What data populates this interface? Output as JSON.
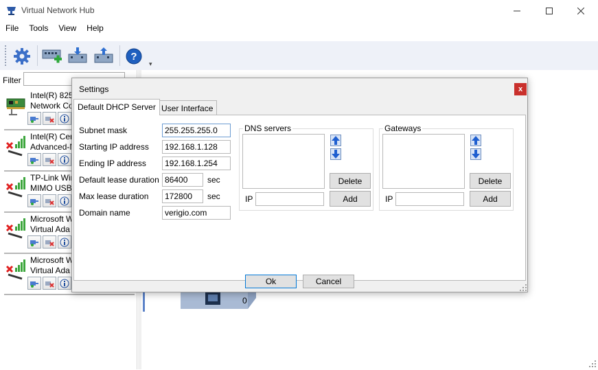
{
  "window": {
    "title": "Virtual Network Hub"
  },
  "menu": [
    "File",
    "Tools",
    "View",
    "Help"
  ],
  "left": {
    "filter_label": "Filter",
    "filter_value": "",
    "adapters": [
      {
        "name_line1": "Intel(R) 825",
        "name_line2": "Network Co",
        "icon": "network-card-icon"
      },
      {
        "name_line1": "Intel(R) Cen",
        "name_line2": "Advanced-N",
        "icon": "wireless-adapter-disconnected-icon"
      },
      {
        "name_line1": "TP-Link Wir",
        "name_line2": "MIMO USB",
        "icon": "wireless-adapter-disconnected-icon"
      },
      {
        "name_line1": "Microsoft W",
        "name_line2": "Virtual Ada",
        "icon": "wireless-adapter-disconnected-icon"
      },
      {
        "name_line1": "Microsoft W",
        "name_line2": "Virtual Ada",
        "icon": "wireless-adapter-disconnected-icon"
      }
    ]
  },
  "hub": {
    "port_count": "0"
  },
  "dialog": {
    "title": "Settings",
    "close_label": "x",
    "tabs": [
      "Default DHCP Server",
      "User Interface"
    ],
    "fields": {
      "subnet_mask": {
        "label": "Subnet mask",
        "value": "255.255.255.0"
      },
      "start_ip": {
        "label": "Starting IP address",
        "value": "192.168.1.128"
      },
      "end_ip": {
        "label": "Ending IP address",
        "value": "192.168.1.254"
      },
      "lease": {
        "label": "Default lease duration",
        "value": "86400",
        "unit": "sec"
      },
      "max_lease": {
        "label": "Max lease duration",
        "value": "172800",
        "unit": "sec"
      },
      "domain": {
        "label": "Domain name",
        "value": "verigio.com"
      }
    },
    "dns": {
      "title": "DNS servers",
      "delete_label": "Delete",
      "ip_label": "IP",
      "ip_value": "",
      "add_label": "Add"
    },
    "gateways": {
      "title": "Gateways",
      "delete_label": "Delete",
      "ip_label": "IP",
      "ip_value": "",
      "add_label": "Add"
    },
    "ok_label": "Ok",
    "cancel_label": "Cancel"
  },
  "colors": {
    "accent": "#0078d7",
    "close_red": "#c9302c",
    "toolbar_bg": "#eef1f8"
  }
}
